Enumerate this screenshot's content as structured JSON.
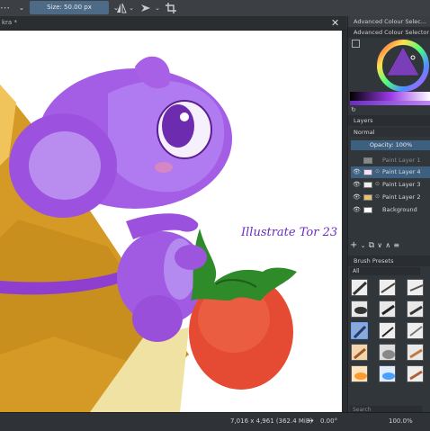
{
  "toolbar": {
    "size_label": "Size: 50.00 px",
    "mirror_icon": "mirror-icon",
    "wraparound_icon": "wraparound-icon",
    "crop_icon": "crop-icon"
  },
  "document": {
    "tab_title": "kra *",
    "signature": "Illustrate Tor 23"
  },
  "color_selector": {
    "tab_title": "Advanced Colour Selec...",
    "title": "Advanced Colour Selector"
  },
  "layers": {
    "title": "Layers",
    "blend_mode": "Normal",
    "opacity": "Opacity:  100%",
    "items": [
      {
        "name": "Paint Layer 1",
        "visible": false,
        "selected": false
      },
      {
        "name": "Paint Layer 4",
        "visible": true,
        "selected": true
      },
      {
        "name": "Paint Layer 3",
        "visible": true,
        "selected": false
      },
      {
        "name": "Paint Layer 2",
        "visible": true,
        "selected": false
      },
      {
        "name": "Background",
        "visible": true,
        "selected": false
      }
    ]
  },
  "brush_presets": {
    "title": "Brush Presets",
    "filter": "All",
    "search_placeholder": "Search"
  },
  "status": {
    "dimensions": "7,016 x 4,961 (362.4 MiB)",
    "rotation": "0.00°",
    "zoom": "100.0%"
  },
  "colors": {
    "accent": "#3d5f80",
    "purple": "#a055e0",
    "cheese": "#d8a02a",
    "strawberry": "#e14a32"
  }
}
